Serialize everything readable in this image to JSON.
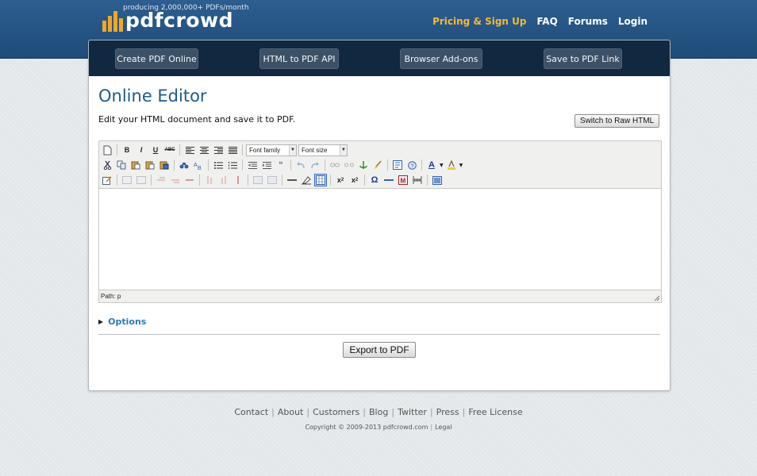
{
  "header": {
    "tagline": "producing 2,000,000+ PDFs/month",
    "logo_text": "pdfcrowd",
    "nav": [
      {
        "label": "Pricing & Sign Up",
        "accent": true
      },
      {
        "label": "FAQ",
        "accent": false
      },
      {
        "label": "Forums",
        "accent": false
      },
      {
        "label": "Login",
        "accent": false
      }
    ]
  },
  "main_nav": [
    {
      "label": "Create PDF Online"
    },
    {
      "label": "HTML to PDF API"
    },
    {
      "label": "Browser Add-ons"
    },
    {
      "label": "Save to PDF Link"
    }
  ],
  "page": {
    "title": "Online Editor",
    "subtitle": "Edit your HTML document and save it to PDF.",
    "raw_html_button": "Switch to Raw HTML",
    "options_label": "Options",
    "export_button": "Export to PDF"
  },
  "editor": {
    "font_family_placeholder": "Font family",
    "font_size_placeholder": "Font size",
    "path_label": "Path: p",
    "content": ""
  },
  "footer": {
    "links": [
      "Contact",
      "About",
      "Customers",
      "Blog",
      "Twitter",
      "Press",
      "Free License"
    ],
    "copyright": "Copyright © 2009-2013 pdfcrowd.com",
    "legal": "Legal"
  },
  "colors": {
    "header_bg": "#245484",
    "nav_bar_bg": "#102840",
    "accent": "#f5b835",
    "title": "#215a88",
    "link": "#2a7ab8"
  }
}
